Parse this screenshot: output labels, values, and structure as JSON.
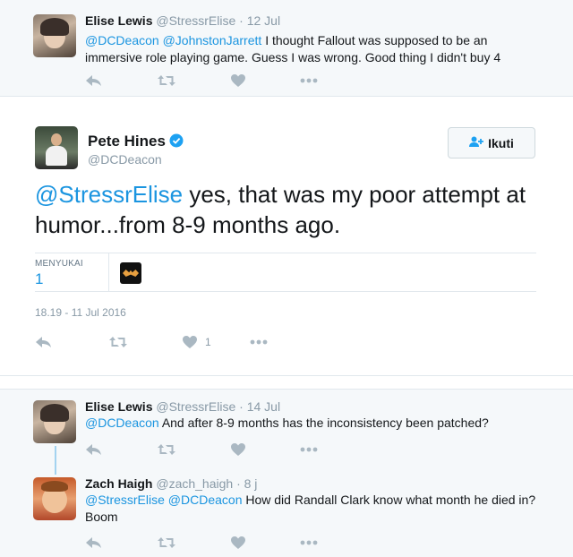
{
  "context_tweet": {
    "name": "Elise Lewis",
    "handle": "@StressrElise",
    "time": "· 12 Jul",
    "mention1": "@DCDeacon",
    "mention2": "@JohnstonJarrett",
    "text_line1": "I thought Fallout was supposed to be an",
    "text_line2": "immersive role playing game. Guess I was wrong. Good thing I didn't buy 4"
  },
  "main_tweet": {
    "name": "Pete Hines",
    "handle": "@DCDeacon",
    "follow_label": "Ikuti",
    "mention": "@StressrElise",
    "text": "yes, that was my poor attempt at humor...from 8-9 months ago.",
    "likes_label": "MENYUKAI",
    "likes_value": "1",
    "timestamp": "18.19 - 11 Jul 2016",
    "like_count": "1"
  },
  "replies": [
    {
      "name": "Elise Lewis",
      "handle": "@StressrElise",
      "time": "· 14 Jul",
      "mention1": "@DCDeacon",
      "text": "And after 8-9 months has the inconsistency been patched?"
    },
    {
      "name": "Zach Haigh",
      "handle": "@zach_haigh",
      "time": "· 8 j",
      "mention1": "@StressrElise",
      "mention2": "@DCDeacon",
      "text_line1": "How did Randall Clark know what month he died in?",
      "text_line2": "Boom"
    }
  ],
  "icons": {
    "reply": "reply-icon",
    "retweet": "retweet-icon",
    "like": "heart-icon",
    "more": "more-icon",
    "verified": "verified-badge-icon",
    "follow": "follow-person-icon"
  },
  "colors": {
    "link": "#1b95e0",
    "muted": "#8899a6",
    "icon": "#aab8c2",
    "thread": "#a3d3f0"
  }
}
